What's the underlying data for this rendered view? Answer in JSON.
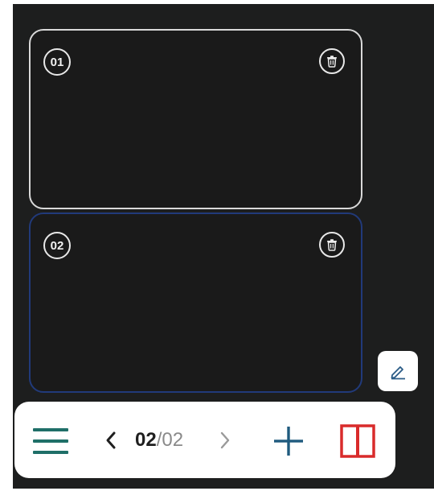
{
  "pages": [
    {
      "number": "01"
    },
    {
      "number": "02"
    }
  ],
  "pager": {
    "current": "02",
    "separator": "/",
    "total": "02"
  },
  "icons": {
    "delete": "trash-icon",
    "edit": "pencil-icon",
    "menu": "hamburger-menu-icon",
    "prev": "chevron-left-icon",
    "next": "chevron-right-icon",
    "add": "plus-icon",
    "split": "split-view-icon"
  },
  "colors": {
    "background": "#1d1e1e",
    "active_page_border": "#213a7a",
    "page_border": "#d9d9d9",
    "teal_accent": "#1f6f68",
    "split_red": "#d92b2b"
  }
}
